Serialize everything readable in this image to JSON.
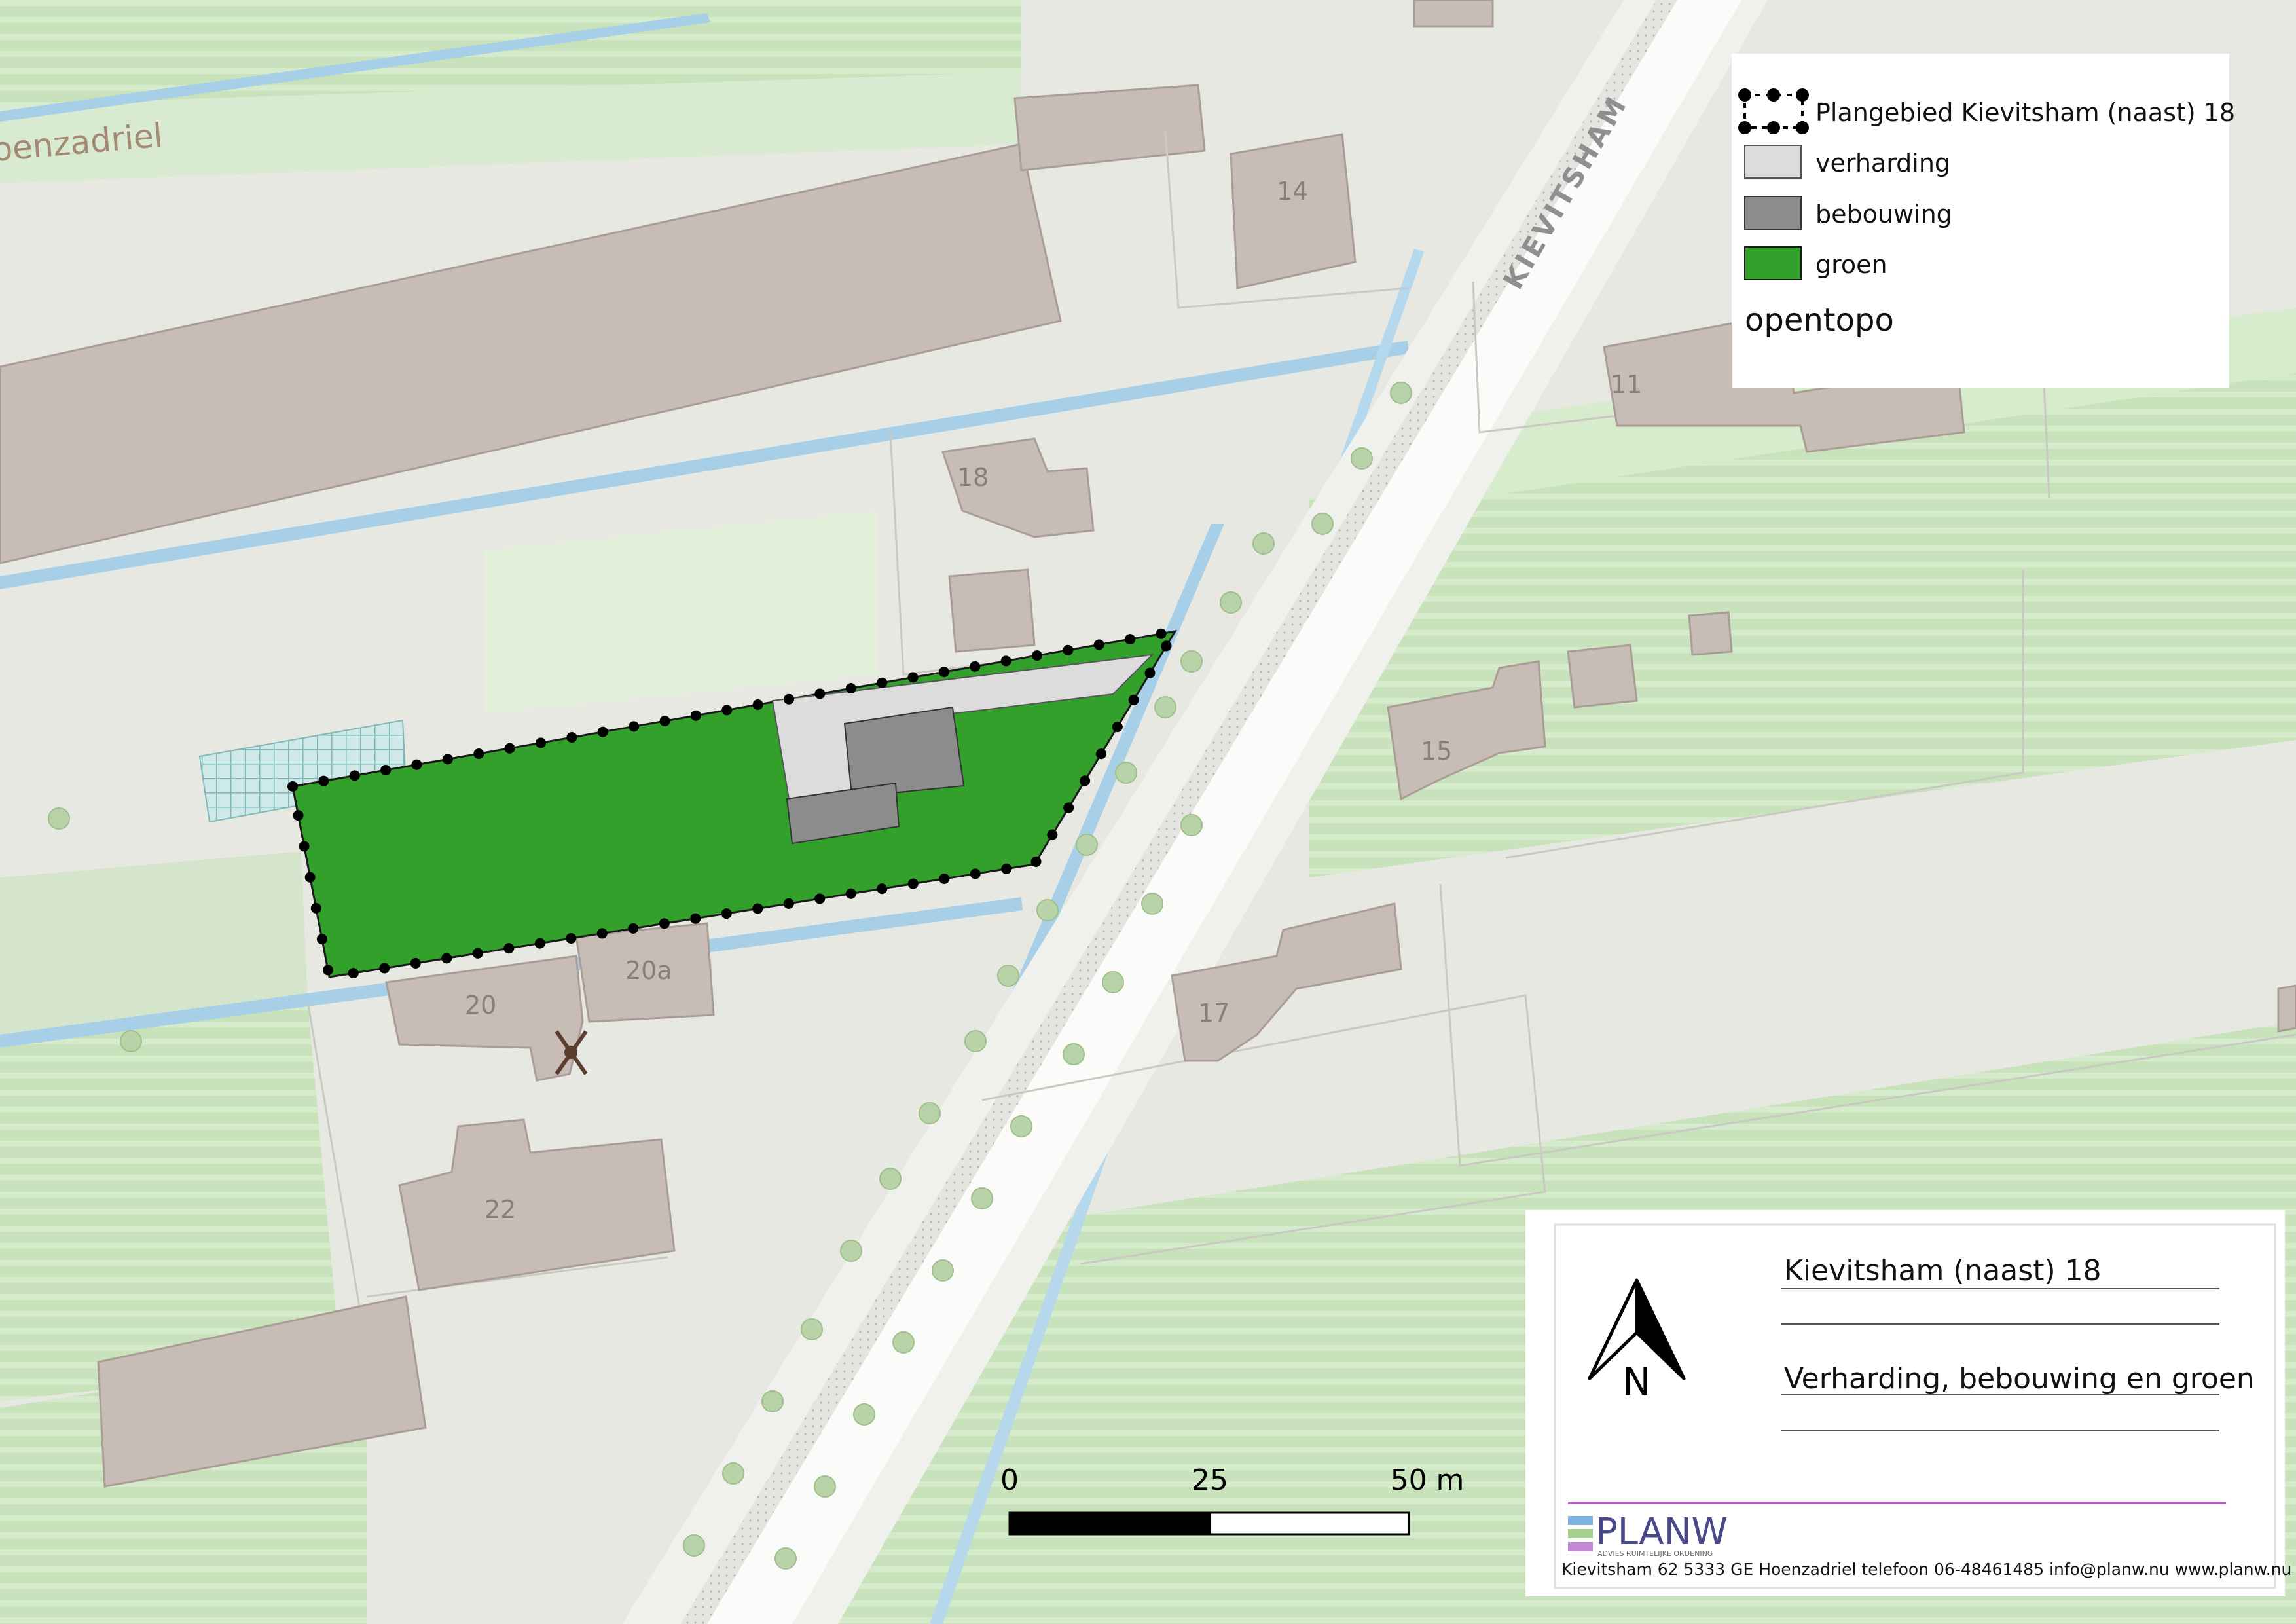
{
  "map": {
    "street_labels": {
      "road": "KIEVITSHAM",
      "village": "oenzadriel"
    },
    "house_numbers": {
      "n14": "14",
      "n11": "11",
      "n18": "18",
      "n15": "15",
      "n17": "17",
      "n20": "20",
      "n20a": "20a",
      "n22": "22"
    }
  },
  "legend": {
    "items": [
      {
        "label": "Plangebied Kievitsham (naast) 18"
      },
      {
        "label": "verharding",
        "color": "#dcdcdc"
      },
      {
        "label": "bebouwing",
        "color": "#8c8c8c"
      },
      {
        "label": "groen",
        "color": "#33a02c"
      }
    ],
    "basemap": "opentopo"
  },
  "scalebar": {
    "tick0": "0",
    "tick1": "25",
    "tick2": "50 m"
  },
  "titleblock": {
    "title": "Kievitsham (naast) 18",
    "subtitle": "Verharding, bebouwing en groen",
    "north_label": "N",
    "logo_text": "PLANW",
    "logo_tagline": "ADVIES RUIMTELIJKE ORDENING",
    "footer": "Kievitsham 62 5333 GE Hoenzadriel telefoon 06-48461485 info@planw.nu www.planw.nu"
  },
  "colors": {
    "plan_fill": "#33a02c",
    "verharding": "#dcdcdc",
    "bebouwing": "#8c8c8c",
    "building": "#c7bcb6",
    "meadow": "#cfe6c3",
    "water": "#a8cfe8"
  }
}
